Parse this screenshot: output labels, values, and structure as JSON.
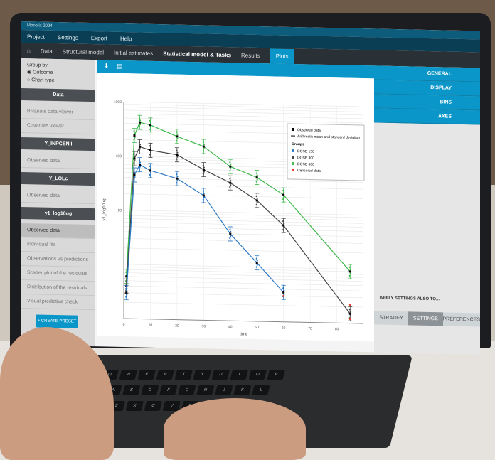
{
  "window": {
    "title": "Monolix 2024",
    "menu": [
      "Project",
      "Settings",
      "Export",
      "Help"
    ],
    "tabs": [
      "Data",
      "Structural model",
      "Initial estimates",
      "Statistical model & Tasks",
      "Results",
      "Plots"
    ]
  },
  "left_panel": {
    "group_by_label": "Group by:",
    "options": [
      "Outcome",
      "Chart type"
    ],
    "sections": [
      {
        "head": "Data",
        "items": [
          "Bivariate data viewer",
          "Covariate viewer"
        ]
      },
      {
        "head": "Y_INPCSNII",
        "items": [
          "Observed data"
        ]
      },
      {
        "head": "Y_LOLc",
        "items": [
          "Observed data"
        ]
      },
      {
        "head": "y1_log10ug",
        "items": [
          "Observed data",
          "Individual fits",
          "Observations vs predictions",
          "Scatter plot of the residuals",
          "Distribution of the residuals",
          "Visual predictive check"
        ]
      }
    ],
    "create_preset": "+ CREATE PRESET"
  },
  "right_panel": {
    "buttons": [
      "GENERAL",
      "DISPLAY",
      "BINS",
      "AXES"
    ],
    "apply_label": "APPLY SETTINGS ALSO TO...",
    "bottom_tabs": [
      "STRATIFY",
      "SETTINGS",
      "PREFERENCES"
    ]
  },
  "plot": {
    "legend": {
      "items": [
        "Observed data",
        "Arithmetic mean and standard deviation"
      ],
      "groups_title": "Groups",
      "groups": [
        "DOSE 150",
        "DOSE 300",
        "DOSE 600",
        "Censored data"
      ]
    },
    "colors": {
      "dose150": "#2b78c4",
      "dose300": "#444444",
      "dose600": "#3cb84a",
      "censored": "#e53a2c"
    },
    "xlabel": "time",
    "ylabel": "y1_log10ug",
    "x_ticks": [
      "0",
      "10",
      "20",
      "30",
      "40",
      "50",
      "60",
      "70",
      "80"
    ],
    "y_ticks": [
      "1000",
      "100",
      "10"
    ]
  },
  "chart_data": {
    "type": "line",
    "xlabel": "time",
    "ylabel": "y1_log10ug",
    "log_y": true,
    "series": [
      {
        "name": "DOSE 600",
        "x": [
          1,
          4,
          6,
          10,
          20,
          30,
          40,
          50,
          60,
          85
        ],
        "values": [
          0.6,
          240,
          420,
          380,
          240,
          160,
          70,
          45,
          22,
          0.9
        ]
      },
      {
        "name": "DOSE 300",
        "x": [
          1,
          4,
          6,
          10,
          20,
          30,
          40,
          50,
          60,
          85
        ],
        "values": [
          0.4,
          90,
          150,
          130,
          110,
          60,
          35,
          17,
          6,
          0.15
        ]
      },
      {
        "name": "DOSE 150",
        "x": [
          1,
          4,
          6,
          10,
          20,
          30,
          40,
          50,
          60
        ],
        "values": [
          0.3,
          45,
          70,
          55,
          40,
          20,
          4,
          1.2,
          0.35
        ]
      }
    ]
  }
}
